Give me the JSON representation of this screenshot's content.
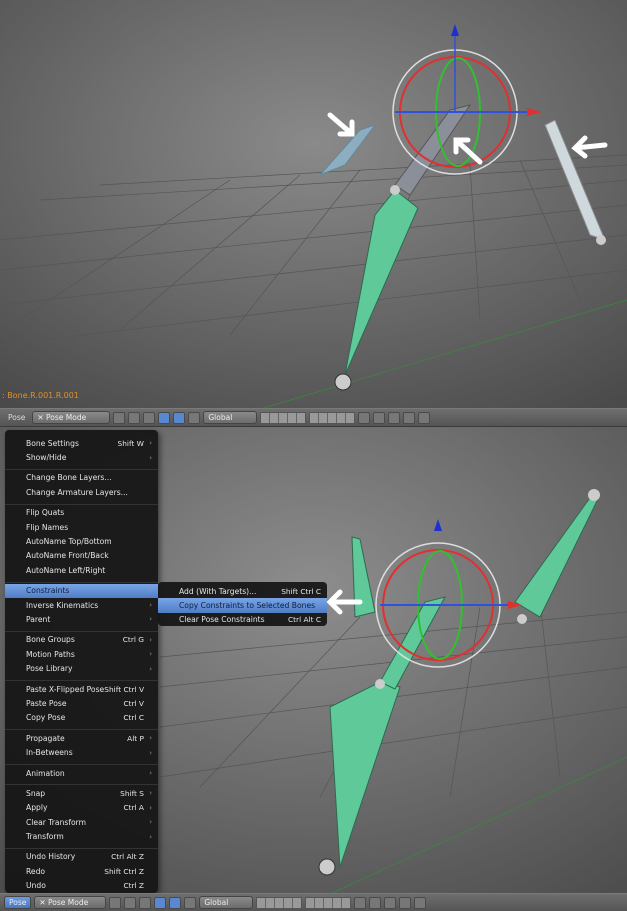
{
  "top_view": {
    "active_bone": ": Bone.R.001.R.001"
  },
  "header": {
    "menu": "Pose",
    "mode": "Pose Mode",
    "orientation": "Global"
  },
  "pose_menu": {
    "groups": [
      [
        {
          "label": "Bone Settings",
          "shortcut": "Shift W",
          "submenu": true
        },
        {
          "label": "Show/Hide",
          "shortcut": "",
          "submenu": true
        }
      ],
      [
        {
          "label": "Change Bone Layers...",
          "shortcut": "",
          "submenu": false
        },
        {
          "label": "Change Armature Layers...",
          "shortcut": "",
          "submenu": false
        }
      ],
      [
        {
          "label": "Flip Quats",
          "shortcut": "",
          "submenu": false
        },
        {
          "label": "Flip Names",
          "shortcut": "",
          "submenu": false
        },
        {
          "label": "AutoName Top/Bottom",
          "shortcut": "",
          "submenu": false
        },
        {
          "label": "AutoName Front/Back",
          "shortcut": "",
          "submenu": false
        },
        {
          "label": "AutoName Left/Right",
          "shortcut": "",
          "submenu": false
        }
      ],
      [
        {
          "label": "Constraints",
          "shortcut": "",
          "submenu": true,
          "highlighted": true
        },
        {
          "label": "Inverse Kinematics",
          "shortcut": "",
          "submenu": true
        },
        {
          "label": "Parent",
          "shortcut": "",
          "submenu": true
        }
      ],
      [
        {
          "label": "Bone Groups",
          "shortcut": "Ctrl G",
          "submenu": true
        },
        {
          "label": "Motion Paths",
          "shortcut": "",
          "submenu": true
        },
        {
          "label": "Pose Library",
          "shortcut": "",
          "submenu": true
        }
      ],
      [
        {
          "label": "Paste X-Flipped Pose",
          "shortcut": "Shift Ctrl V",
          "submenu": false
        },
        {
          "label": "Paste Pose",
          "shortcut": "Ctrl V",
          "submenu": false
        },
        {
          "label": "Copy Pose",
          "shortcut": "Ctrl C",
          "submenu": false
        }
      ],
      [
        {
          "label": "Propagate",
          "shortcut": "Alt P",
          "submenu": true
        },
        {
          "label": "In-Betweens",
          "shortcut": "",
          "submenu": true
        }
      ],
      [
        {
          "label": "Animation",
          "shortcut": "",
          "submenu": true
        }
      ],
      [
        {
          "label": "Snap",
          "shortcut": "Shift S",
          "submenu": true
        },
        {
          "label": "Apply",
          "shortcut": "Ctrl A",
          "submenu": true
        },
        {
          "label": "Clear Transform",
          "shortcut": "",
          "submenu": true
        },
        {
          "label": "Transform",
          "shortcut": "",
          "submenu": true
        }
      ],
      [
        {
          "label": "Undo History",
          "shortcut": "Ctrl Alt Z",
          "submenu": false
        },
        {
          "label": "Redo",
          "shortcut": "Shift Ctrl Z",
          "submenu": false
        },
        {
          "label": "Undo",
          "shortcut": "Ctrl Z",
          "submenu": false
        }
      ]
    ]
  },
  "constraints_submenu": [
    {
      "label": "Add (With Targets)...",
      "shortcut": "Shift Ctrl C"
    },
    {
      "label": "Copy Constraints to Selected Bones",
      "shortcut": "",
      "highlighted": true
    },
    {
      "label": "Clear Pose Constraints",
      "shortcut": "Ctrl Alt C"
    }
  ],
  "colors": {
    "bone_selected": "#5fc99a",
    "highlight": "#5a88d0",
    "bone_name": "#e0902a"
  }
}
